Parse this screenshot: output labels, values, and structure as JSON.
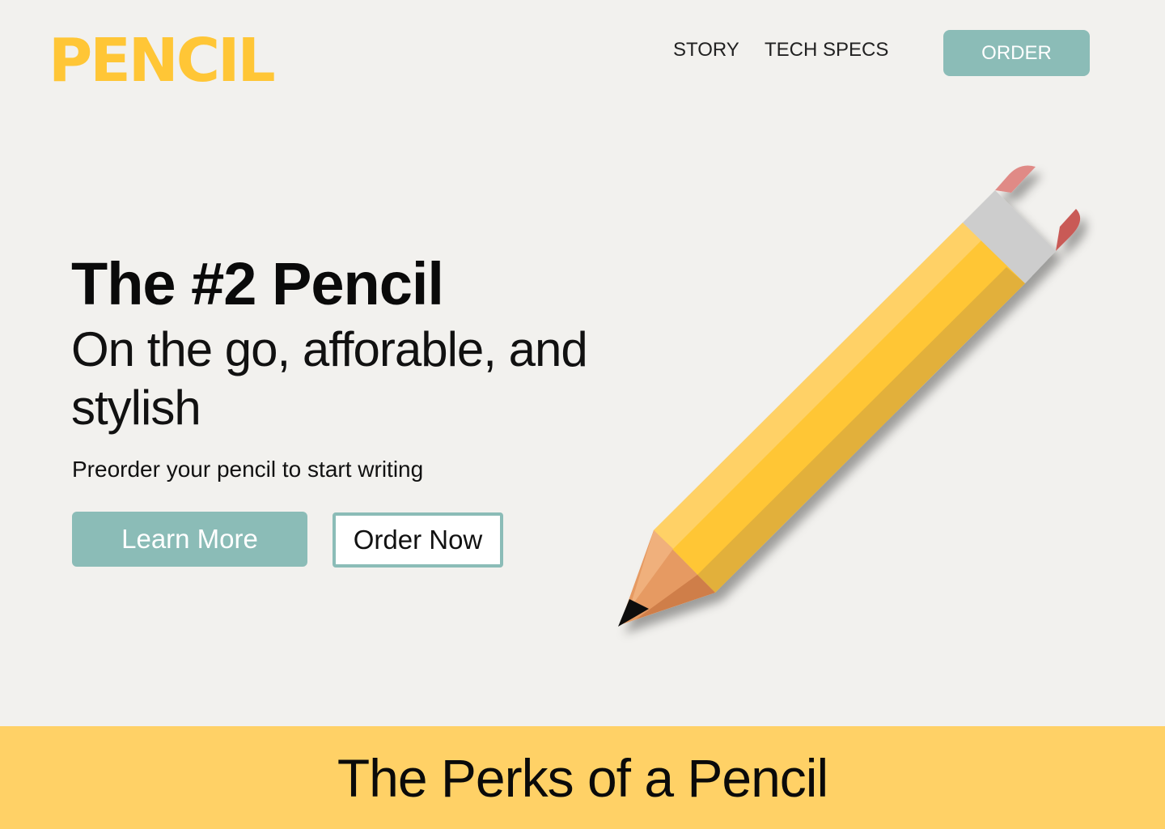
{
  "header": {
    "logo": "PENCIL",
    "nav": {
      "story": "STORY",
      "tech_specs": "TECH SPECS"
    },
    "order_label": "ORDER"
  },
  "hero": {
    "title": "The #2 Pencil",
    "subtitle": "On the go, afforable, and stylish",
    "text": "Preorder your pencil to start writing",
    "learn_more_label": "Learn More",
    "order_now_label": "Order Now",
    "illustration": "pencil-illustration"
  },
  "perks": {
    "title": "The Perks of a Pencil"
  },
  "colors": {
    "background": "#f2f1ee",
    "brand_yellow": "#ffc636",
    "accent_teal": "#8bbcb7",
    "band_yellow": "#ffd166"
  }
}
